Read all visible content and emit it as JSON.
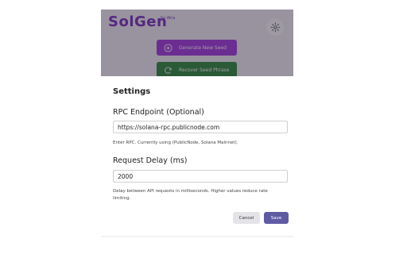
{
  "app": {
    "logo": "SolGen",
    "logo_sub": "by Atra",
    "settings_icon": "gear-icon",
    "brand_color": "#7b2fbf"
  },
  "background_buttons": {
    "generate_label": "Generate New Seed",
    "generate_icon": "plus-circle-icon",
    "recover_label": "Recover Seed Phrase",
    "recover_icon": "refresh-icon"
  },
  "modal": {
    "title": "Settings",
    "rpc_label": "RPC Endpoint (Optional)",
    "rpc_value": "https://solana-rpc.publicnode.com",
    "rpc_hint": "Enter RPC. Currently using (PublicNode, Solana Mainnet).",
    "delay_label": "Request Delay (ms)",
    "delay_value": "2000",
    "delay_hint": "Delay between API requests in milliseconds. Higher values reduce rate limiting.",
    "cancel_label": "Cancel",
    "save_label": "Save",
    "save_color": "#5f5ba3"
  }
}
